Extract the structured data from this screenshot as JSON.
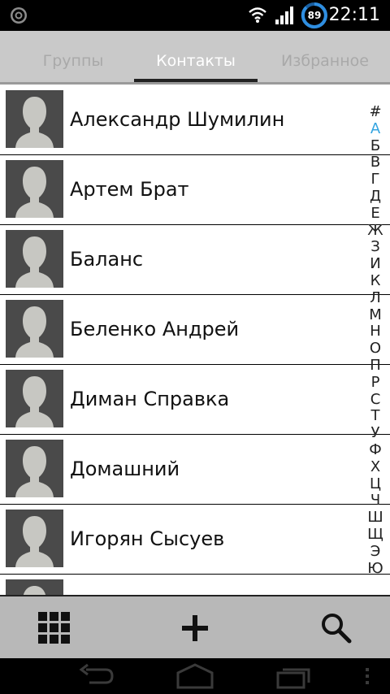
{
  "status": {
    "battery_level": "89",
    "time": "22:11",
    "icons": [
      "app-notification-icon",
      "wifi-icon",
      "signal-icon",
      "battery-icon"
    ]
  },
  "tabs": [
    {
      "label": "Группы",
      "selected": false
    },
    {
      "label": "Контакты",
      "selected": true
    },
    {
      "label": "Избранное",
      "selected": false
    }
  ],
  "contacts": [
    "Александр Шумилин",
    "Артем Брат",
    "Баланс",
    "Беленко Андрей",
    "Диман Справка",
    "Домашний",
    "Игорян Сысуев",
    ""
  ],
  "alphabet": [
    "#",
    "А",
    "Б",
    "В",
    "Г",
    "Д",
    "Е",
    "Ж",
    "З",
    "И",
    "К",
    "Л",
    "М",
    "Н",
    "О",
    "П",
    "Р",
    "С",
    "Т",
    "У",
    "Ф",
    "Х",
    "Ц",
    "Ч",
    "Ш",
    "Щ",
    "Э",
    "Ю"
  ],
  "alphabet_active": "А",
  "actions": [
    "dialpad-icon",
    "add-contact-icon",
    "search-icon"
  ],
  "nav": [
    "back-icon",
    "home-icon",
    "recent-apps-icon",
    "menu-icon"
  ],
  "colors": {
    "accent": "#33a4e0",
    "tabbar": "#c9c9c9",
    "actionbar": "#b8b8b8"
  }
}
